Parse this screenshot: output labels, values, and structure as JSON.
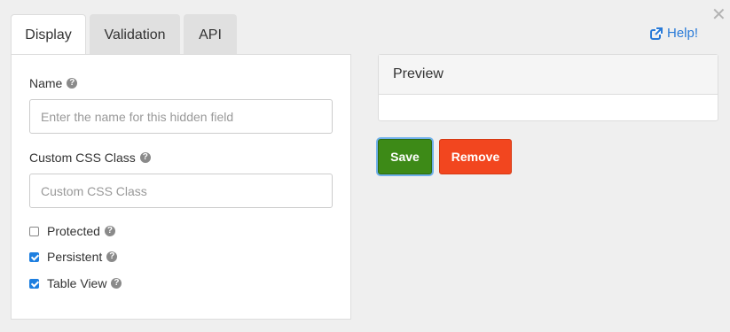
{
  "tabs": [
    {
      "label": "Display"
    },
    {
      "label": "Validation"
    },
    {
      "label": "API"
    }
  ],
  "help": {
    "label": "Help!"
  },
  "form": {
    "name_label": "Name",
    "name_placeholder": "Enter the name for this hidden field",
    "css_label": "Custom CSS Class",
    "css_placeholder": "Custom CSS Class",
    "checkboxes": [
      {
        "label": "Protected",
        "checked": false
      },
      {
        "label": "Persistent",
        "checked": true
      },
      {
        "label": "Table View",
        "checked": true
      }
    ]
  },
  "preview": {
    "title": "Preview"
  },
  "actions": {
    "save_label": "Save",
    "remove_label": "Remove"
  },
  "colors": {
    "accent": "#2a7bd8",
    "save": "#3d8a17",
    "remove": "#f2461f"
  },
  "icons": {
    "close": "close-icon",
    "help": "external-link-icon",
    "info": "question-circle-icon"
  }
}
